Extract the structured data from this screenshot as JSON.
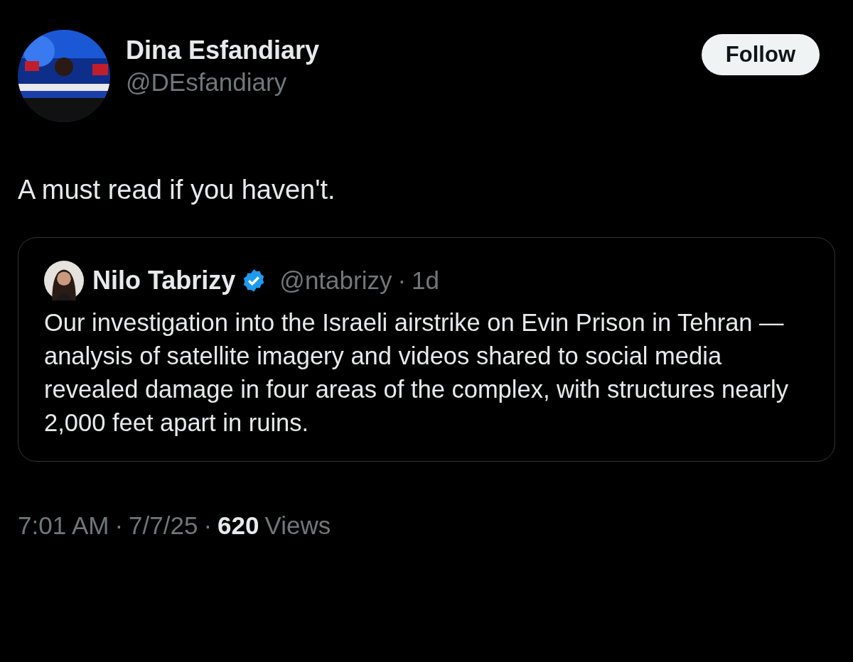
{
  "author": {
    "name": "Dina Esfandiary",
    "handle": "@DEsfandiary"
  },
  "follow_button": "Follow",
  "text": "A must read if you haven't.",
  "quoted": {
    "name": "Nilo Tabrizy",
    "verified": true,
    "handle": "@ntabrizy",
    "separator": "·",
    "time": "1d",
    "text": "Our investigation into the Israeli airstrike on Evin Prison in Tehran — analysis of satellite imagery and videos shared to social media revealed damage in four areas of the complex, with structures nearly 2,000 feet apart in ruins."
  },
  "meta": {
    "time": "7:01 AM",
    "separator_1": "·",
    "date": "7/7/25",
    "separator_2": "·",
    "views": "620",
    "views_label": "Views"
  }
}
